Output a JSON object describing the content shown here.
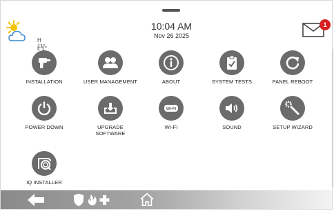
{
  "status_bar": {
    "weather": {
      "icon": "partly-sunny-icon",
      "high": "H 11°",
      "low": "L 1°"
    },
    "time": "10:04 AM",
    "date": "Nov 26 2025",
    "messages": {
      "icon": "mail-icon",
      "count": "1",
      "badge_color": "#d81e1e"
    }
  },
  "menu": {
    "items": [
      {
        "label": "INSTALLATION",
        "icon": "drill-icon"
      },
      {
        "label": "USER MANAGEMENT",
        "icon": "users-icon"
      },
      {
        "label": "ABOUT",
        "icon": "info-icon"
      },
      {
        "label": "SYSTEM TESTS",
        "icon": "clipboard-check-icon"
      },
      {
        "label": "PANEL REBOOT",
        "icon": "reboot-icon"
      },
      {
        "label": "POWER DOWN",
        "icon": "power-icon"
      },
      {
        "label": "UPGRADE\nSOFTWARE",
        "icon": "upgrade-software-icon"
      },
      {
        "label": "WI-FI",
        "icon": "wifi-icon"
      },
      {
        "label": "SOUND",
        "icon": "speaker-icon"
      },
      {
        "label": "SETUP WIZARD",
        "icon": "wand-icon"
      },
      {
        "label": "IQ INSTALLER",
        "icon": "iq-installer-icon"
      }
    ]
  },
  "bottom_bar": {
    "items": [
      "back-arrow-icon",
      "emergency-icons",
      "home-icon"
    ]
  },
  "colors": {
    "icon_circle": "#6b6b6b",
    "badge": "#d81e1e"
  }
}
